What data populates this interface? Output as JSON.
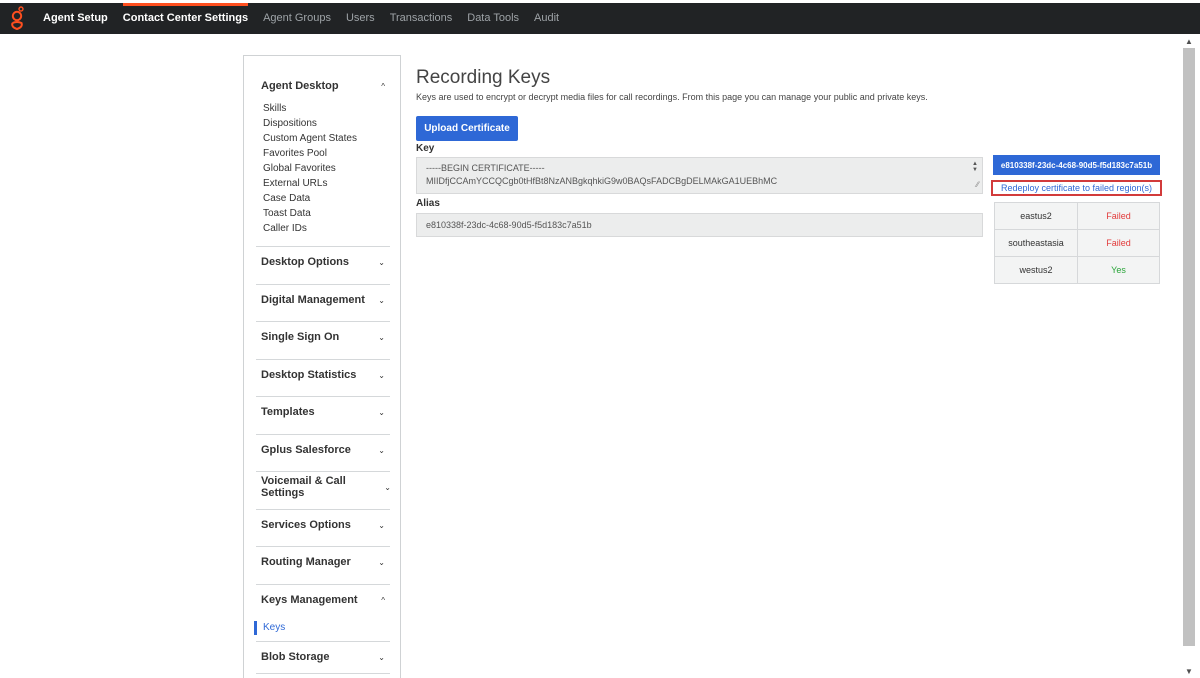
{
  "topnav": {
    "items": [
      {
        "label": "Agent Setup",
        "bold": true,
        "active": false
      },
      {
        "label": "Contact Center Settings",
        "bold": true,
        "active": true
      },
      {
        "label": "Agent Groups",
        "bold": false,
        "active": false
      },
      {
        "label": "Users",
        "bold": false,
        "active": false
      },
      {
        "label": "Transactions",
        "bold": false,
        "active": false
      },
      {
        "label": "Data Tools",
        "bold": false,
        "active": false
      },
      {
        "label": "Audit",
        "bold": false,
        "active": false
      }
    ],
    "accent_color": "#ff4f1f"
  },
  "sidebar": {
    "agent_desktop": {
      "title": "Agent Desktop",
      "items": [
        "Skills",
        "Dispositions",
        "Custom Agent States",
        "Favorites Pool",
        "Global Favorites",
        "External URLs",
        "Case Data",
        "Toast Data",
        "Caller IDs"
      ]
    },
    "sections": [
      "Desktop Options",
      "Digital Management",
      "Single Sign On",
      "Desktop Statistics",
      "Templates",
      "Gplus Salesforce",
      "Voicemail & Call Settings",
      "Services Options",
      "Routing Manager"
    ],
    "keys_management": {
      "title": "Keys Management",
      "active_item": "Keys"
    },
    "blob_storage": "Blob Storage"
  },
  "main": {
    "title": "Recording Keys",
    "description": "Keys are used to encrypt or decrypt media files for call recordings. From this page you can manage your public and private keys.",
    "upload_button": "Upload Certificate",
    "key_label": "Key",
    "key_line1": "-----BEGIN CERTIFICATE-----",
    "key_line2": "MIIDfjCCAmYCCQCgb0tHfBt8NzANBgkqhkiG9w0BAQsFADCBgDELMAkGA1UEBhMC",
    "alias_label": "Alias",
    "alias_value": "e810338f-23dc-4c68-90d5-f5d183c7a51b"
  },
  "right_panel": {
    "cert_id": "e810338f-23dc-4c68-90d5-f5d183c7a51b",
    "redeploy_link": "Redeploy certificate to failed region(s)",
    "regions": [
      {
        "name": "eastus2",
        "status": "Failed"
      },
      {
        "name": "southeastasia",
        "status": "Failed"
      },
      {
        "name": "westus2",
        "status": "Yes"
      }
    ],
    "failed_color": "#e23b3b",
    "success_color": "#2aa53a"
  }
}
